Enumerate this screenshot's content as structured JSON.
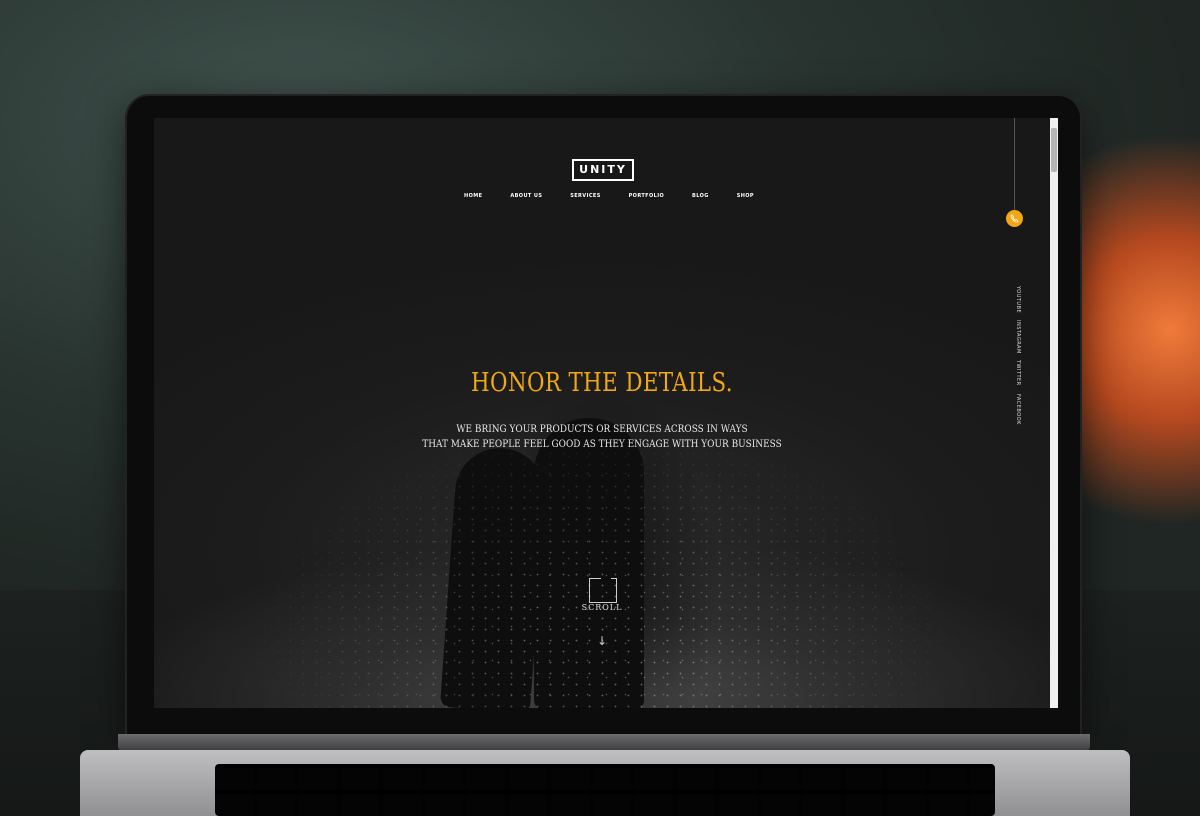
{
  "site": {
    "logo_text": "UNITY",
    "nav": [
      "HOME",
      "ABOUT US",
      "SERVICES",
      "PORTFOLIO",
      "BLOG",
      "SHOP"
    ]
  },
  "hero": {
    "headline": "HONOR THE DETAILS.",
    "subline_1": "WE BRING YOUR PRODUCTS OR SERVICES ACROSS IN WAYS",
    "subline_2": "THAT MAKE PEOPLE FEEL GOOD AS THEY ENGAGE WITH YOUR BUSINESS",
    "scroll_label": "SCROLL"
  },
  "social": [
    "YOUTUBE",
    "INSTAGRAM",
    "TWITTER",
    "FACEBOOK"
  ],
  "colors": {
    "accent": "#f2a814",
    "background": "#1a1a1a",
    "text": "#ffffff"
  },
  "icons": {
    "phone": "phone-icon",
    "arrow": "arrow-down-icon"
  }
}
